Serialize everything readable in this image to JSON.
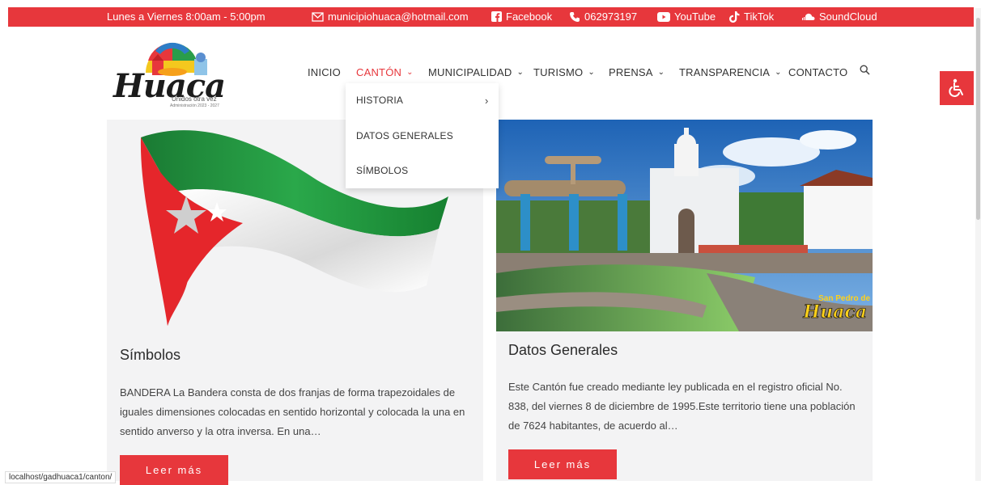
{
  "topbar": {
    "hours": "Lunes a Viernes 8:00am - 5:00pm",
    "email": "municipiohuaca@hotmail.com",
    "facebook": "Facebook",
    "phone": "062973197",
    "youtube": "YouTube",
    "tiktok": "TikTok",
    "soundcloud": "SoundCloud",
    "bg_color": "#e7373c"
  },
  "logo": {
    "word": "Huaca",
    "tagline": "Unidos otra vez",
    "admin": "Administración 2023 - 2027"
  },
  "nav": {
    "inicio": "INICIO",
    "canton": "CANTÓN",
    "municipalidad": "MUNICIPALIDAD",
    "turismo": "TURISMO",
    "prensa": "PRENSA",
    "transparencia": "TRANSPARENCIA",
    "contacto": "CONTACTO"
  },
  "dropdown": {
    "historia": "HISTORIA",
    "datos": "DATOS GENERALES",
    "simbolos": "SÍMBOLOS"
  },
  "cards": [
    {
      "title": "Símbolos",
      "text": "BANDERA La Bandera consta de dos franjas de forma trapezoidales de iguales dimensiones colocadas en sentido horizontal y colocada la una en sentido anverso y la otra inversa. En una…",
      "button": "Leer más"
    },
    {
      "title": "Datos Generales",
      "text": "Este Cantón fue creado mediante ley publicada en el registro oficial No. 838, del viernes 8 de diciembre de 1995.Este territorio tiene una población de 7624 habitantes, de acuerdo al…",
      "button": "Leer más",
      "image_caption_1": "San Pedro de",
      "image_caption_2": "Huaca"
    }
  ],
  "status_url": "localhost/gadhuaca1/canton/",
  "accent_color": "#e7373c"
}
